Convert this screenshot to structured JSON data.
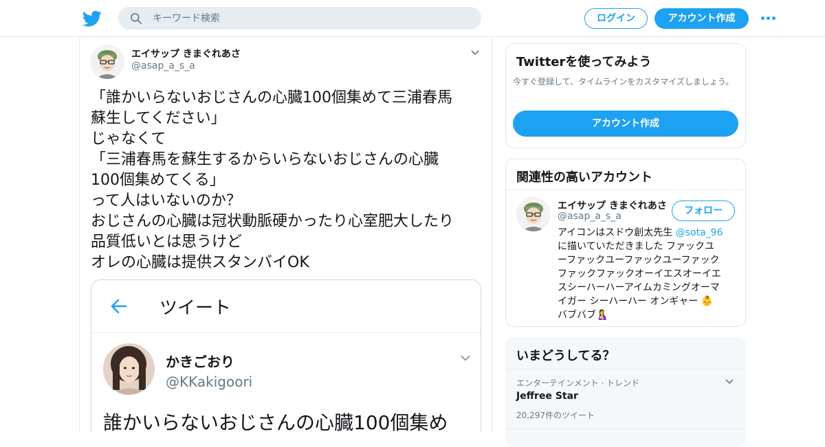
{
  "header": {
    "search_placeholder": "キーワード検索",
    "login_label": "ログイン",
    "signup_label": "アカウント作成"
  },
  "tweet": {
    "author_name": "エイサップ きまぐれあさ",
    "author_handle": "@asap_a_s_a",
    "lines": [
      "「誰かいらないおじさんの心臓100個集めて三浦春馬",
      "蘇生してください」",
      "じゃなくて",
      "「三浦春馬を蘇生するからいらないおじさんの心臓",
      "100個集めてくる」",
      "って人はいないのか？",
      "おじさんの心臓は冠状動脈硬かったり心室肥大したり",
      "品質低いとは思うけど",
      "オレの心臓は提供スタンバイOK"
    ],
    "screenshot": {
      "header_title": "ツイート",
      "quoted_name": "かきごおり",
      "quoted_handle": "@KKakigoori",
      "quoted_text": "誰かいらないおじさんの心臓100個集め"
    }
  },
  "signup_card": {
    "title": "Twitterを使ってみよう",
    "description": "今すぐ登録して、タイムラインをカスタマイズしましょう。",
    "button_label": "アカウント作成"
  },
  "related_card": {
    "title": "関連性の高いアカウント",
    "account_name": "エイサップ きまぐれあさ",
    "account_handle": "@asap_a_s_a",
    "follow_label": "フォロー",
    "bio_lines": [
      {
        "pre": "アイコンはスドウ創太先生 ",
        "mention": "@sota_96",
        "post": ""
      },
      {
        "pre": "に描いていただきました ファックユ",
        "mention": "",
        "post": ""
      },
      {
        "pre": "ーファックユーファックユーファック",
        "mention": "",
        "post": ""
      },
      {
        "pre": "ファックファックオーイエスオーイエ",
        "mention": "",
        "post": ""
      },
      {
        "pre": "スシーハーハーアイムカミングオーマ",
        "mention": "",
        "post": ""
      },
      {
        "pre": "イガー シーハーハー オンギャー 👶",
        "mention": "",
        "post": ""
      },
      {
        "pre": "バブバブ🤱",
        "mention": "",
        "post": ""
      }
    ]
  },
  "trends_card": {
    "title": "いまどうしてる？",
    "category": "エンターテインメント · トレンド",
    "topic": "Jeffree Star",
    "count": "20,297件のツイート"
  },
  "colors": {
    "accent": "#1da1f2",
    "text": "#14171a",
    "secondary_text": "#657786",
    "border": "#e1e8ed"
  },
  "icons": [
    "twitter-bird-icon",
    "search-icon",
    "more-dots-icon",
    "chevron-down-icon",
    "back-arrow-icon"
  ]
}
